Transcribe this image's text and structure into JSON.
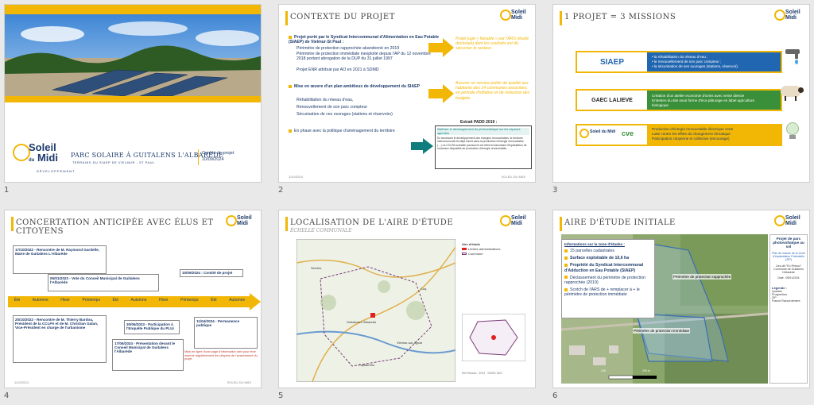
{
  "slides": [
    {
      "number": "1",
      "title": "PARC SOLAIRE À GUITALENS L'ALBARÈDE",
      "subtitle": "TERRAINS DU SIAEP DE VIELMUR - ST PAUL",
      "meta1": "Comité de projet",
      "meta2": "10/09/2024",
      "logo1": "Soleil",
      "logo2": "du",
      "logo3": "Midi",
      "logo4": "DÉVELOPPEMENT"
    },
    {
      "number": "2",
      "title": "CONTEXTE DU PROJET",
      "b1": "Projet porté par le Syndicat Intercommunal d'Alimentation en Eau Potable (SIAEP) de Vielmur-St Paul :",
      "b1a": "Périmètre de protection rapprochée abandonné en 2019",
      "b1b": "Périmètre de protection immédiate inexploité depuis l'AP du 12 novembre 2018 portant abrogation de la DUP du 31 juillet 1997",
      "b1c": "Projet ENR attribué par AO en 2021 à SDMD",
      "b2": "Mise en œuvre d'un plan ambitieux de développement du SIAEP",
      "b2a": "Réhabilitation du réseau d'eau,",
      "b2b": "Renouvellement de son parc compteur",
      "b2c": "Sécurisation de ces ouvrages (stations et réservoirs)",
      "b3": "En phase avec la politique d'aménagement du territoire",
      "arrow1": "Projet jugé « faisable » par l'ARS (étude doctorale) dont les souhaits est de sécuriser le secteur.",
      "arrow2": "Assurer un service public de qualité aux habitants des 14 communes associées, en période d'inflation et de réduction des budgets",
      "box_title": "Extrait PADD 2019 :",
      "box_head": "Maîtriser le développement du photovoltaïque sur les espaces agricoles",
      "box_text": "En favorisant le développement des énergies renouvelables, le territoire intercommunal est déjà inscrit dans la production d'énergie renouvelable. (…) La CCLPA souhaite poursuivre cet effort en favorisant l'implantation de nouveaux dispositifs de production d'énergie renouvelable.",
      "foot_left": "1/10/2024",
      "foot_right": "SOLEIL DU MIDI"
    },
    {
      "number": "3",
      "title": "1 PROJET = 3 MISSIONS",
      "m1_logo": "SIAEP",
      "m1_l1": "la réhabilitation du réseau d'eau ;",
      "m1_l2": "le renouvellement de son parc compteur ;",
      "m1_l3": "la sécurisation de ses ouvrages (stations, réservoir).",
      "m2_logo": "GAEC LALIEVE",
      "m2_l1": "Création d'un atelier economie d'ovins avec vente directe",
      "m2_l2": "Entretien du site sous forme d'éco-pâturage en label agriculture biologique",
      "m3_logo1": "Soleil du Midi",
      "m3_logo2": "cve",
      "m3_l1": "Production d'énergie renouvelable électrique verte",
      "m3_l2": "Lutte contre les effets du changement climatique",
      "m3_l3": "Participation citoyenne et collective (encourage)"
    },
    {
      "number": "4",
      "title": "CONCERTATION ANTICIPÉE AVEC ÉLUS ET CITOYENS",
      "seasons": [
        "Été",
        "Automne",
        "Hiver",
        "Printemps",
        "Été",
        "Automne",
        "Hiver",
        "Printemps",
        "Été",
        "Automne"
      ],
      "e1": "17/10/2022 - Rencontre de M. Raymond Gardelle, Maire de Guitalens L'Albarède",
      "e2": "05/01/2023 - Vote du Conseil Municipal de Guitalens l'Albarède",
      "e3": "10/09/2024 : Comité de projet",
      "e4": "20/10/2022 - Rencontre de M. Thierry Bardou, Président de la CCLPA et de M. Christian Galan, Vice-Président en charge de l'urbanisme",
      "e5": "30/06/2023 - Participation à l'Enquête Publique du PLUi",
      "e6": "17/06/2024 - Présentation devant le Conseil Municipal de Guitalens l'Albarède",
      "e7": "11/04/2024 - Permanence publique",
      "note": "Mise en ligne d'une page d'information web pour tenir informé régulièrement les citoyens de l'avancement du projet",
      "foot_left": "1/10/2024",
      "foot_right": "SOLEIL DU MIDI"
    },
    {
      "number": "5",
      "title": "LOCALISATION DE L'AIRE D'ÉTUDE",
      "subtitle": "ÉCHELLE COMMUNALE",
      "legend_title": "Aire d'étude",
      "legend1": "Limites administratives",
      "legend2": "Commune",
      "place1": "Serviès",
      "place2": "Guitalens-L'Albarède",
      "place3": "Vielmur-sur-Agout",
      "place4": "Puylaurens",
      "place5": "Cuq",
      "footer": "Réf Réseau : 2024 · SDMD SAS"
    },
    {
      "number": "6",
      "title": "AIRE D'ÉTUDE INITIALE",
      "i_head": "Informations sur la zone d'études :",
      "i1": "15 parcelles cadastrales",
      "i2": "Surface exploitable de 10,6 ha",
      "i3": "Propriété du Syndicat Intercommunal d'Adduction en Eau Potable (SIAEP)",
      "i4": "Déclassement du périmètre de protection rapprochée (2019)",
      "i5": "Scotch de l'ARS de + remplacer à + le périmètre de protection immédiate",
      "z1": "Périmètre de protection rapprochée",
      "z2": "Périmètre de protection immédiate",
      "side_title": "Projet de parc photovoltaïque au sol",
      "side_sub": "Plan de masse de la Zone d'Implantation Potentielle (ZIP)",
      "side_place": "Lieu-dit \"En Peisou\" Commune de Guitalens l'Albarède",
      "side_date": "Date : 09/01/2024",
      "legend": "Légende :",
      "leg1": "Quartier",
      "leg2": "Prospection",
      "leg3": "ZIP",
      "leg4": "France Raccordement",
      "scale1": "100",
      "scale2": "200 m"
    }
  ],
  "colors": {
    "yellow": "#f2b705",
    "navy": "#1d3a6b",
    "teal": "#0f7d7e",
    "green": "#3a8f3a"
  }
}
